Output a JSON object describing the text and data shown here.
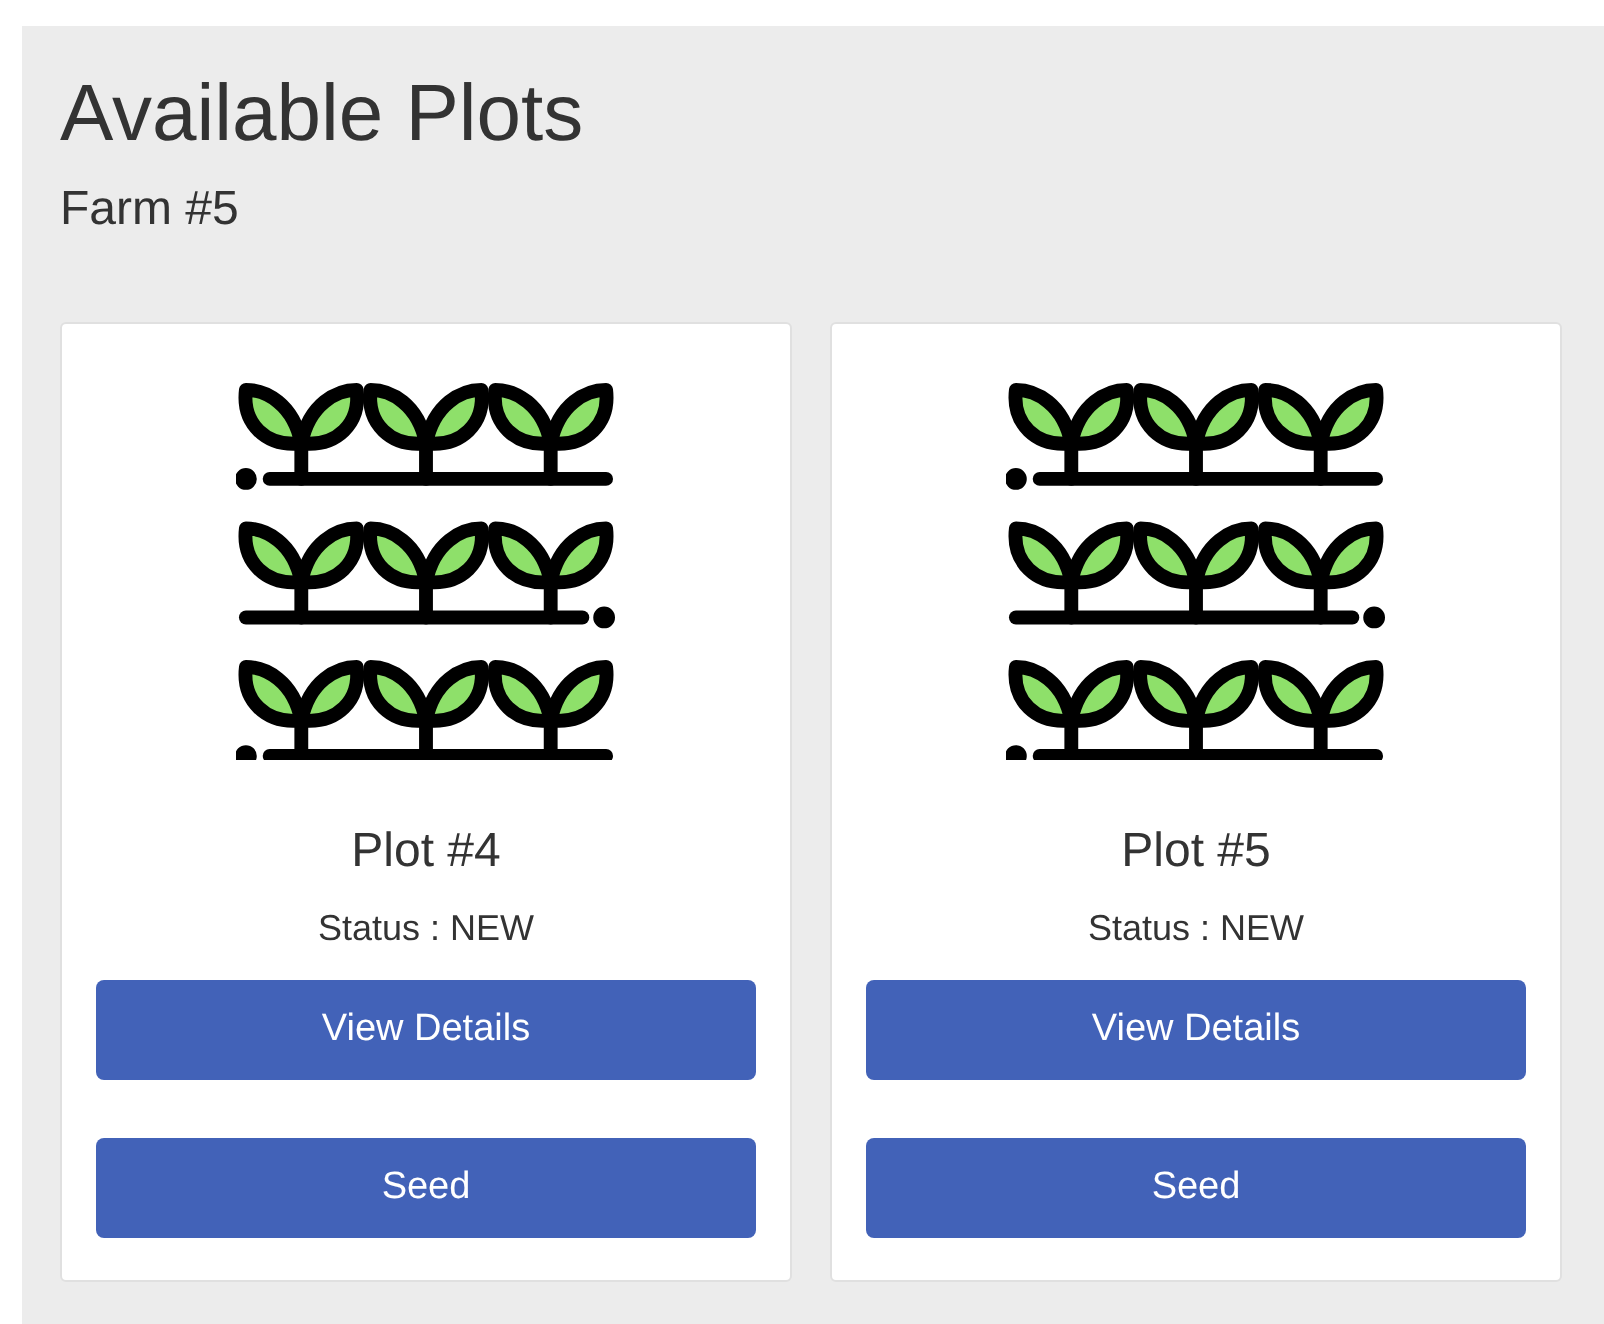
{
  "title": "Available Plots",
  "subtitle": "Farm #5",
  "plots": [
    {
      "name": "Plot #4",
      "status": "Status : NEW",
      "buttons": [
        "View Details",
        "Seed"
      ]
    },
    {
      "name": "Plot #5",
      "status": "Status : NEW",
      "buttons": [
        "View Details",
        "Seed"
      ]
    }
  ]
}
